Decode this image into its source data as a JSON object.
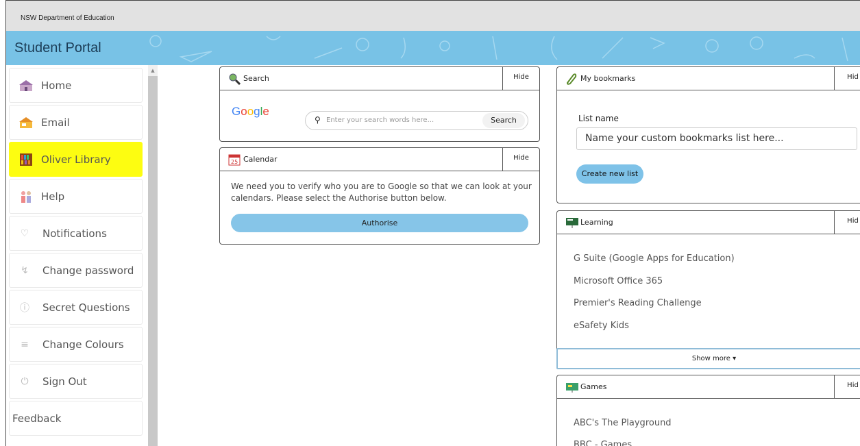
{
  "header": {
    "org": "NSW Department of Education",
    "portal_title": "Student Portal"
  },
  "sidebar": {
    "items": [
      {
        "label": "Home",
        "icon": "school-building-icon"
      },
      {
        "label": "Email",
        "icon": "house-mail-icon"
      },
      {
        "label": "Oliver Library",
        "icon": "library-books-icon",
        "highlighted": true
      },
      {
        "label": "Help",
        "icon": "help-people-icon"
      },
      {
        "label": "Notifications",
        "icon": "bell-icon"
      },
      {
        "label": "Change password",
        "icon": "key-icon"
      },
      {
        "label": "Secret Questions",
        "icon": "question-circle-icon"
      },
      {
        "label": "Change Colours",
        "icon": "list-icon"
      },
      {
        "label": "Sign Out",
        "icon": "power-icon"
      },
      {
        "label": "Feedback"
      }
    ],
    "highlight_color": "#fdfd11"
  },
  "search_panel": {
    "title": "Search",
    "hide_label": "Hide",
    "logo": "Google",
    "placeholder": "Enter your search words here...",
    "button": "Search"
  },
  "calendar_panel": {
    "title": "Calendar",
    "hide_label": "Hide",
    "calendar_day": "25",
    "message": "We need you to verify who you are to Google so that we can look at your calendars. Please select the Authorise button below.",
    "button": "Authorise"
  },
  "bookmarks_panel": {
    "title": "My bookmarks",
    "hide_label": "Hid",
    "list_name_label": "List name",
    "list_name_placeholder": "Name your custom bookmarks list here...",
    "create_button": "Create new list"
  },
  "learning_panel": {
    "title": "Learning",
    "hide_label": "Hid",
    "links": [
      "G Suite (Google Apps for Education)",
      "Microsoft Office 365",
      "Premier's Reading Challenge",
      "eSafety Kids"
    ],
    "show_more": "Show more ▾"
  },
  "games_panel": {
    "title": "Games",
    "hide_label": "Hid",
    "links": [
      "ABC's The Playground",
      "BBC - Games"
    ]
  },
  "colors": {
    "banner": "#78c2e6",
    "button_blue": "#86c5e8"
  }
}
